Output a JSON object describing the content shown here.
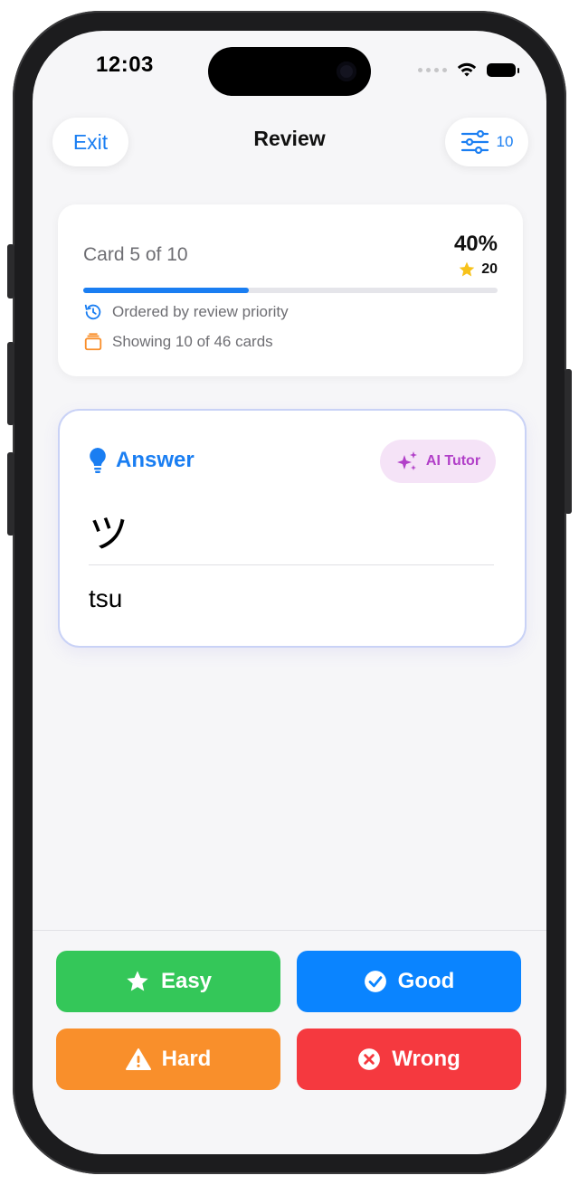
{
  "status": {
    "time": "12:03"
  },
  "nav": {
    "exit_label": "Exit",
    "title": "Review",
    "filter_count": "10"
  },
  "progress": {
    "card_label": "Card 5 of 10",
    "percent_label": "40%",
    "percent": 40,
    "stars": "20",
    "order_text": "Ordered by review priority",
    "showing_text": "Showing 10 of 46 cards"
  },
  "answer": {
    "heading": "Answer",
    "ai_label": "AI Tutor",
    "kana": "ツ",
    "romaji": "tsu"
  },
  "grades": {
    "easy": "Easy",
    "good": "Good",
    "hard": "Hard",
    "wrong": "Wrong"
  },
  "colors": {
    "accent": "#1a7ef2",
    "easy": "#34c759",
    "good": "#0a84ff",
    "hard": "#f98f2b",
    "wrong": "#f5393f",
    "ai": "#b13fc8",
    "star": "#f7c21a"
  }
}
